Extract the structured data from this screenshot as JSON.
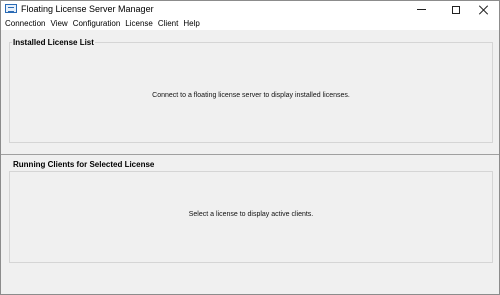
{
  "window": {
    "title": "Floating License Server Manager",
    "icon": "server-app-icon"
  },
  "menu": {
    "items": [
      "Connection",
      "View",
      "Configuration",
      "License",
      "Client",
      "Help"
    ]
  },
  "installed": {
    "title": "Installed License List",
    "message": "Connect to a floating license server to display installed licenses."
  },
  "clients": {
    "title": "Running Clients for Selected License",
    "message": "Select a license to display active clients."
  }
}
